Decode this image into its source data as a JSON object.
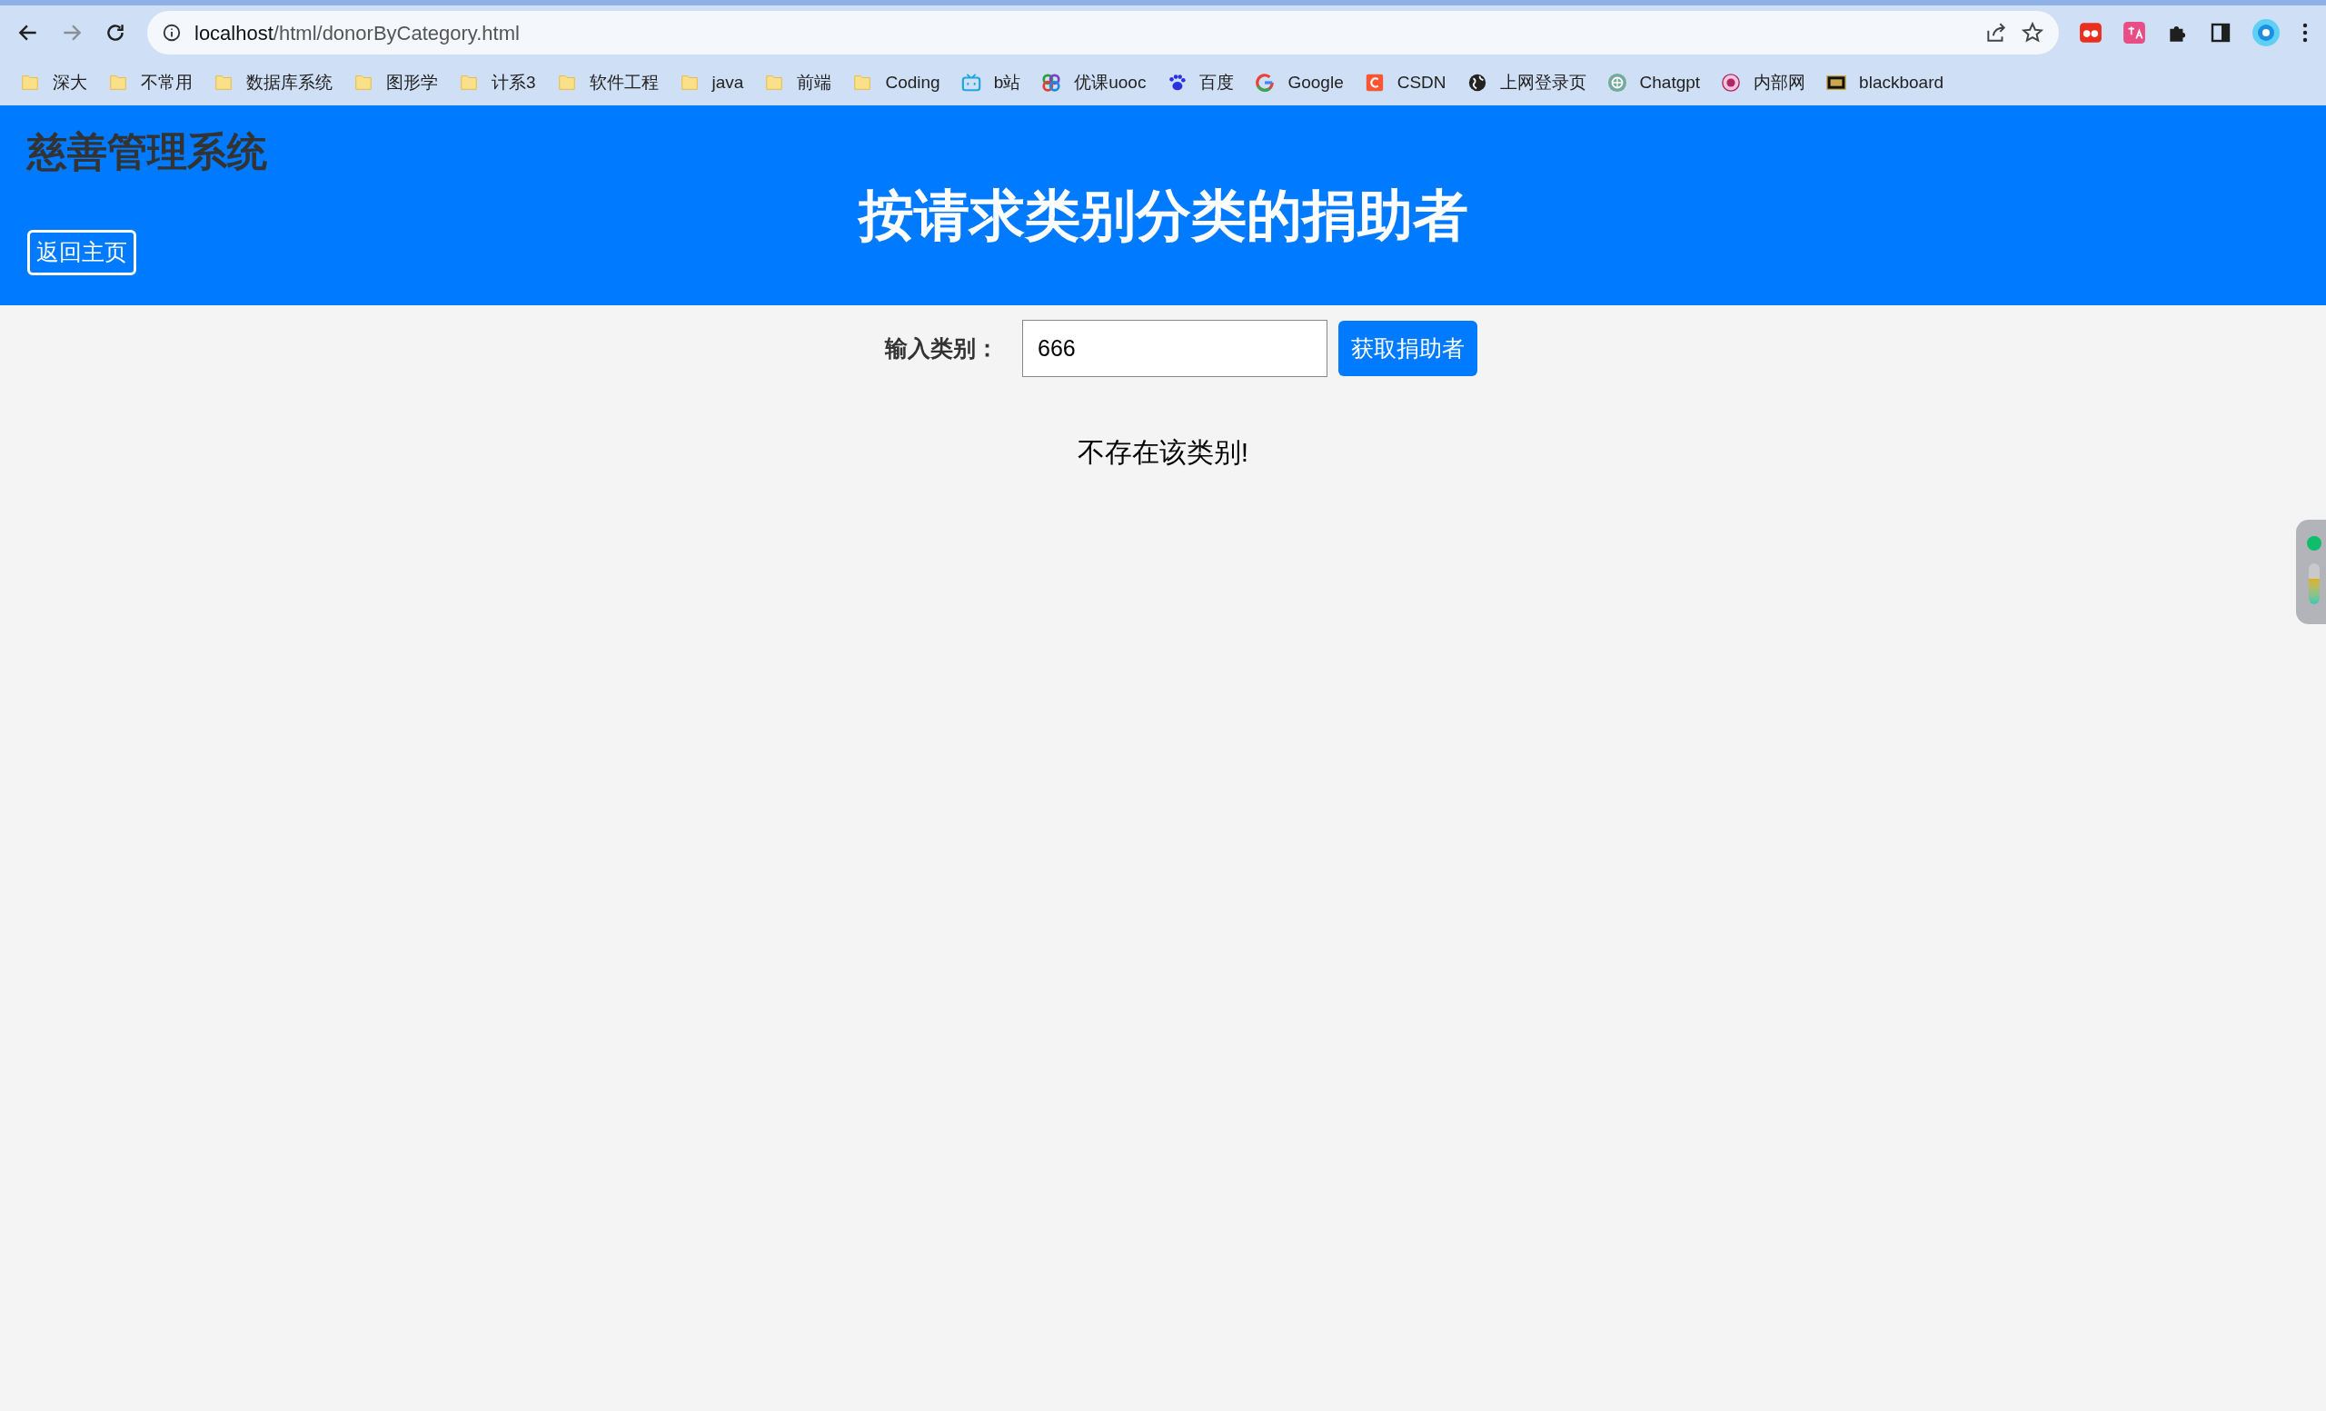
{
  "browser": {
    "address": {
      "host": "localhost",
      "path": "/html/donorByCategory.html"
    },
    "forward_disabled": true
  },
  "bookmarks": [
    {
      "label": "深大",
      "kind": "folder"
    },
    {
      "label": "不常用",
      "kind": "folder"
    },
    {
      "label": "数据库系统",
      "kind": "folder"
    },
    {
      "label": "图形学",
      "kind": "folder"
    },
    {
      "label": "计系3",
      "kind": "folder"
    },
    {
      "label": "软件工程",
      "kind": "folder"
    },
    {
      "label": "java",
      "kind": "folder"
    },
    {
      "label": "前端",
      "kind": "folder"
    },
    {
      "label": "Coding",
      "kind": "folder"
    },
    {
      "label": "b站",
      "kind": "tv"
    },
    {
      "label": "优课uooc",
      "kind": "rings"
    },
    {
      "label": "百度",
      "kind": "paw"
    },
    {
      "label": "Google",
      "kind": "gcircle"
    },
    {
      "label": "CSDN",
      "kind": "square"
    },
    {
      "label": "上网登录页",
      "kind": "globe"
    },
    {
      "label": "Chatgpt",
      "kind": "knot"
    },
    {
      "label": "内部网",
      "kind": "seal"
    },
    {
      "label": "blackboard",
      "kind": "plate"
    }
  ],
  "header": {
    "site_title": "慈善管理系统",
    "heading": "按请求类别分类的捐助者",
    "home_button": "返回主页"
  },
  "form": {
    "label": "输入类别：",
    "value": "666",
    "submit": "获取捐助者"
  },
  "message": "不存在该类别!"
}
